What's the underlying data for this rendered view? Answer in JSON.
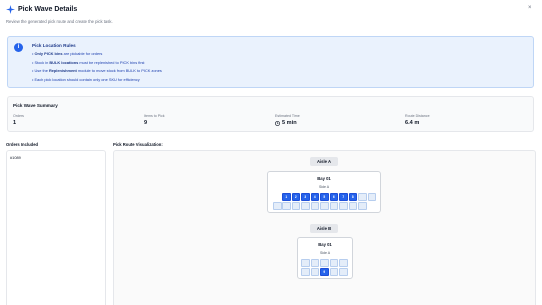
{
  "header": {
    "title": "Pick Wave Details",
    "subtitle": "Review the generated pick route and create the pick task.",
    "close_label": "×"
  },
  "rules": {
    "title": "Pick Location Rules",
    "items": [
      {
        "bold": "Only PICK bins",
        "text": " are pickable for orders",
        "prefix": "• "
      },
      {
        "prefix": "• Stock in ",
        "bold": "BULK locations",
        "text": " must be replenished to PICK bins first"
      },
      {
        "prefix": "• Use the ",
        "bold": "Replenishment",
        "text": " module to move stock from BULK to PICK zones"
      },
      {
        "prefix": "• Each pick location should contain only one SKU for efficiency",
        "bold": "",
        "text": ""
      }
    ]
  },
  "summary": {
    "title": "Pick Wave Summary",
    "orders_label": "Orders",
    "orders_value": "1",
    "items_label": "Items to Pick",
    "items_value": "9",
    "time_label": "Estimated Time",
    "time_value": "5 min",
    "distance_label": "Route Distance",
    "distance_value": "6.4 m"
  },
  "orders": {
    "title": "Orders Included",
    "items": [
      "#1089"
    ]
  },
  "route": {
    "title": "Pick Route Visualization:",
    "aisles": [
      {
        "label": "Aisle A",
        "bay": "Bay 01",
        "side": "Side A",
        "active_slots": [
          "1",
          "2",
          "3",
          "4",
          "5",
          "6",
          "7",
          "8"
        ]
      },
      {
        "label": "Aisle B",
        "bay": "Bay 01",
        "side": "Side A",
        "active_slots": [
          "9"
        ]
      }
    ]
  },
  "colors": {
    "accent": "#2563eb",
    "rules_bg": "#eaf2fd",
    "slot_empty": "#e4edf9"
  }
}
